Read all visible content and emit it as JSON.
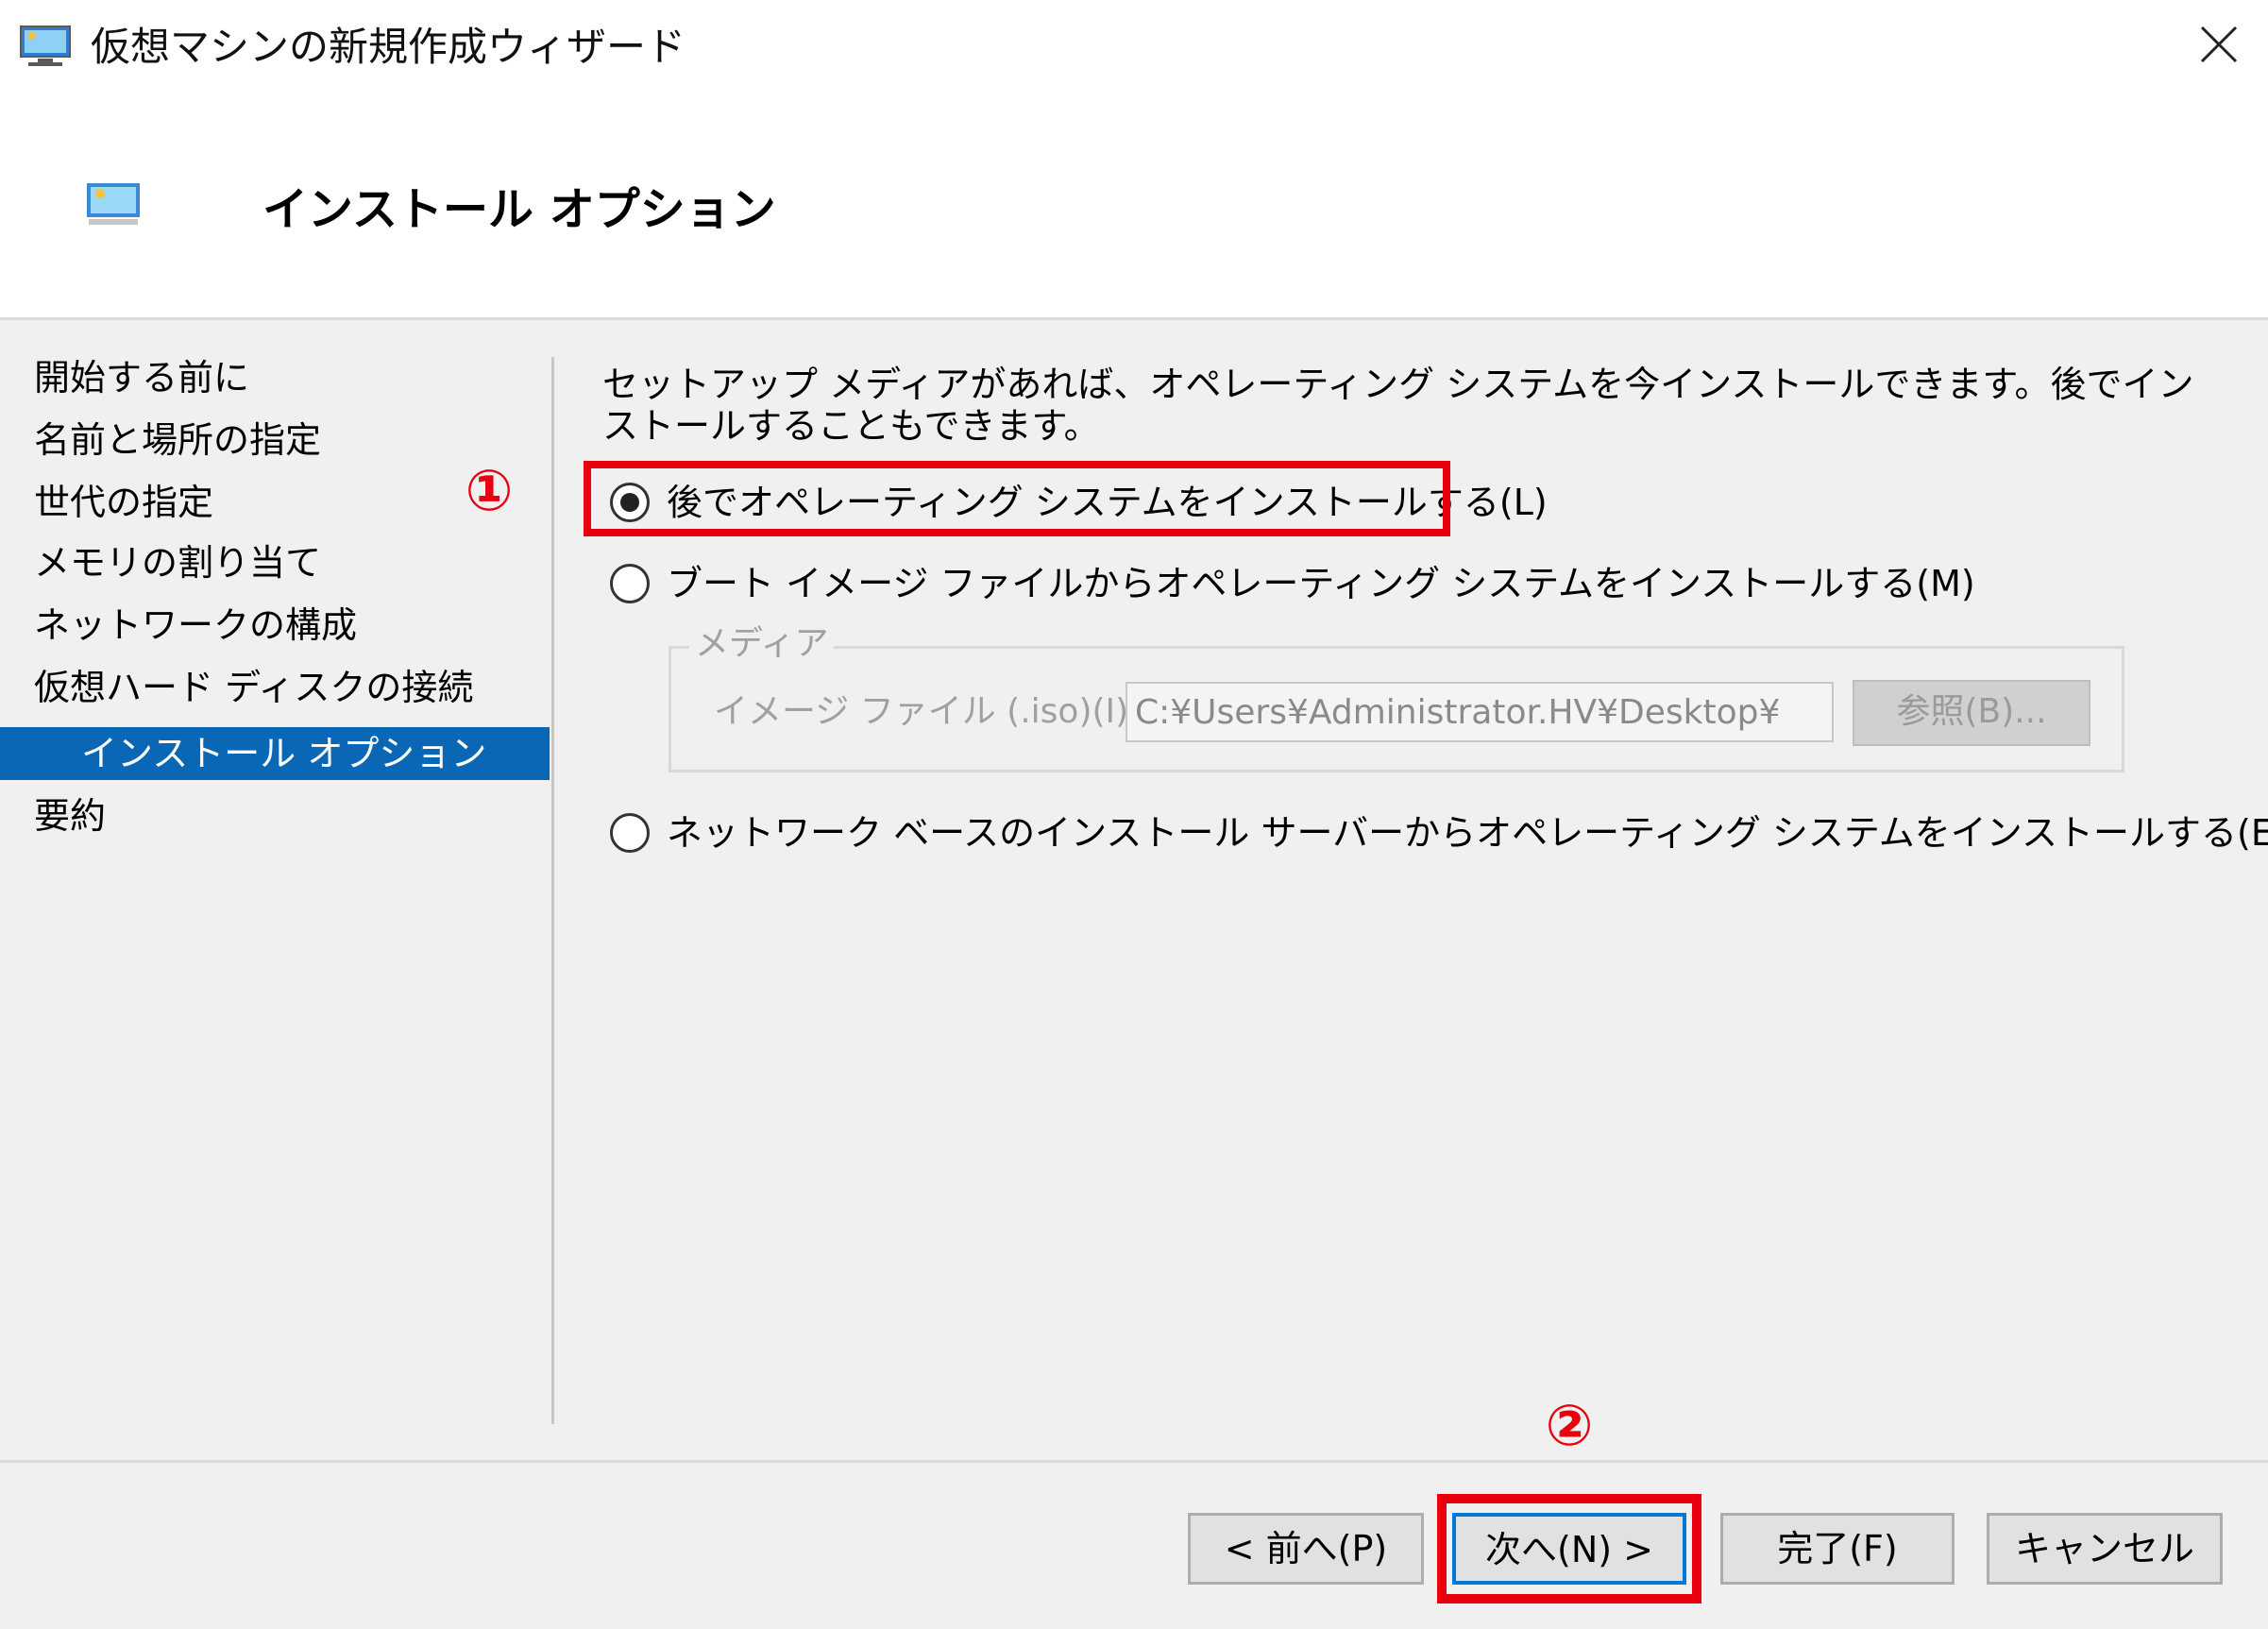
{
  "window": {
    "title": "仮想マシンの新規作成ウィザード",
    "close_icon": "close-x-icon"
  },
  "header": {
    "icon": "virtual-machine-icon",
    "title": "インストール オプション"
  },
  "steps": [
    {
      "label": "開始する前に"
    },
    {
      "label": "名前と場所の指定"
    },
    {
      "label": "世代の指定"
    },
    {
      "label": "メモリの割り当て"
    },
    {
      "label": "ネットワークの構成"
    },
    {
      "label": "仮想ハード ディスクの接続"
    },
    {
      "label": "インストール オプション",
      "active": true
    },
    {
      "label": "要約"
    }
  ],
  "intro_text": "セットアップ メディアがあれば、オペレーティング システムを今インストールできます。後でインストールすることもできます。",
  "options": [
    {
      "label": "後でオペレーティング システムをインストールする(L)",
      "checked": true
    },
    {
      "label": "ブート イメージ ファイルからオペレーティング システムをインストールする(M)",
      "checked": false
    },
    {
      "label": "ネットワーク ベースのインストール サーバーからオペレーティング システムをインストールする(E)",
      "checked": false
    }
  ],
  "media": {
    "legend": "メディア",
    "iso_label": "イメージ ファイル (.iso)(I):",
    "iso_value": "C:¥Users¥Administrator.HV¥Desktop¥",
    "browse_label": "参照(B)...",
    "enabled": false
  },
  "buttons": {
    "back": "< 前へ(P)",
    "next": "次へ(N) >",
    "finish": "完了(F)",
    "cancel": "キャンセル"
  },
  "annotations": {
    "marker_1": "①",
    "marker_2": "②",
    "highlight_color": "#e8000f"
  },
  "colors": {
    "active_step_bg": "#0a67b6",
    "default_button_border": "#0078d7"
  }
}
